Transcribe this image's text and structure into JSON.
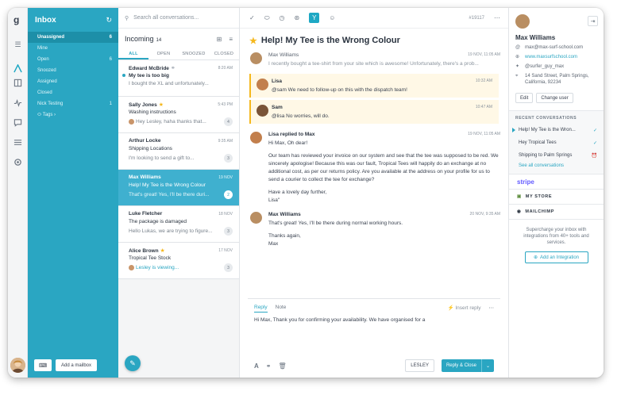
{
  "mailbox": {
    "title": "Inbox",
    "items": [
      {
        "label": "Unassigned",
        "count": "6"
      },
      {
        "label": "Mine",
        "count": ""
      },
      {
        "label": "Open",
        "count": "6"
      },
      {
        "label": "Snoozed",
        "count": ""
      },
      {
        "label": "Assigned",
        "count": ""
      },
      {
        "label": "Closed",
        "count": ""
      },
      {
        "label": "Nick Testing",
        "count": "1"
      },
      {
        "label": "Tags",
        "count": ""
      }
    ],
    "add_mailbox_label": "Add a mailbox"
  },
  "conversations": {
    "search_placeholder": "Search all conversations...",
    "heading": "Incoming",
    "heading_count": "14",
    "tabs": [
      "ALL",
      "OPEN",
      "SNOOZED",
      "CLOSED"
    ],
    "items": [
      {
        "name": "Edward McBride",
        "time": "8:20 AM",
        "subject": "My tee is too big",
        "preview": "I bought the XL and unfortunately...",
        "count": ""
      },
      {
        "name": "Sally Jones",
        "time": "5:43 PM",
        "subject": "Washing instructions",
        "preview": "Hey Lesley, haha thanks that...",
        "count": "4"
      },
      {
        "name": "Arthur Locke",
        "time": "9:35 AM",
        "subject": "Shipping Locations",
        "preview": "I'm looking to send a gift to...",
        "count": "3"
      },
      {
        "name": "Max Williams",
        "time": "19 NOV",
        "subject": "Help! My Tee is the Wrong Colour",
        "preview": "That's great! Yes, I'll be there duri...",
        "count": "2"
      },
      {
        "name": "Luke Fletcher",
        "time": "18 NOV",
        "subject": "The package is damaged",
        "preview": "Hello Lukas, we are trying to figure...",
        "count": "3"
      },
      {
        "name": "Alice Brown",
        "time": "17 NOV",
        "subject": "Tropical Tee Stock",
        "preview": "Lesley is viewing...",
        "count": "3"
      }
    ]
  },
  "main": {
    "ticket_number": "#19117",
    "subject": "Help! My Tee is the Wrong Colour",
    "messages": [
      {
        "name": "Max Williams",
        "time": "19 NOV, 11:05 AM",
        "body": "I recently bought a tee-shirt from your site which is awesome! Unfortunately, there's a prob..."
      },
      {
        "name": "Lisa",
        "time": "10:32 AM",
        "body": "@sam We need to follow-up on this with the dispatch team!"
      },
      {
        "name": "Sam",
        "time": "10:47 AM",
        "body": "@lisa No worries, will do."
      },
      {
        "name": "Lisa replied to Max",
        "time": "19 NOV, 11:05 AM",
        "body_lines": [
          "Hi Max, Oh dear!",
          "Our team has reviewed your invoice on our system and see that the tee was supposed to be red. We sincerely apologise! Because this was our fault, Tropical Tees will happily do an exchange at no additional cost, as per our returns policy. Are you available at the address on your profile for us to send a courier to collect the tee for exchange?",
          "Have a lovely day further,",
          "Lisa\""
        ]
      },
      {
        "name": "Max Williams",
        "time": "20 NOV, 9:35 AM",
        "body_lines": [
          "That's great! Yes, I'll be there during normal working hours.",
          "Thanks again,",
          "Max"
        ]
      }
    ],
    "reply": {
      "tab_reply": "Reply",
      "tab_note": "Note",
      "insert_reply": "Insert reply",
      "text": "Hi Max, Thank you for confirming your availability. We have organised for a",
      "assignee": "LESLEY",
      "send_label": "Reply & Close"
    }
  },
  "sidebar": {
    "name": "Max Williams",
    "email": "max@max-surf-school.com",
    "website": "www.maxsurfschool.com",
    "twitter": "@surfer_guy_max",
    "address": "14 Sand Street, Palm Springs, California, 92234",
    "edit_label": "Edit",
    "change_user_label": "Change user",
    "recent_title": "RECENT CONVERSATIONS",
    "recent": [
      {
        "label": "Help! My Tee is the Wron...",
        "status": "✓"
      },
      {
        "label": "Hey Tropical Tees",
        "status": "✓"
      },
      {
        "label": "Shipping to Palm Springs",
        "status": "⏰"
      }
    ],
    "see_all": "See all conversations",
    "integrations": [
      "stripe",
      "MY STORE",
      "MAILCHIMP"
    ],
    "promo_text": "Supercharge your inbox with integrations from 40+ tools and services.",
    "promo_button": "Add an Integration"
  }
}
